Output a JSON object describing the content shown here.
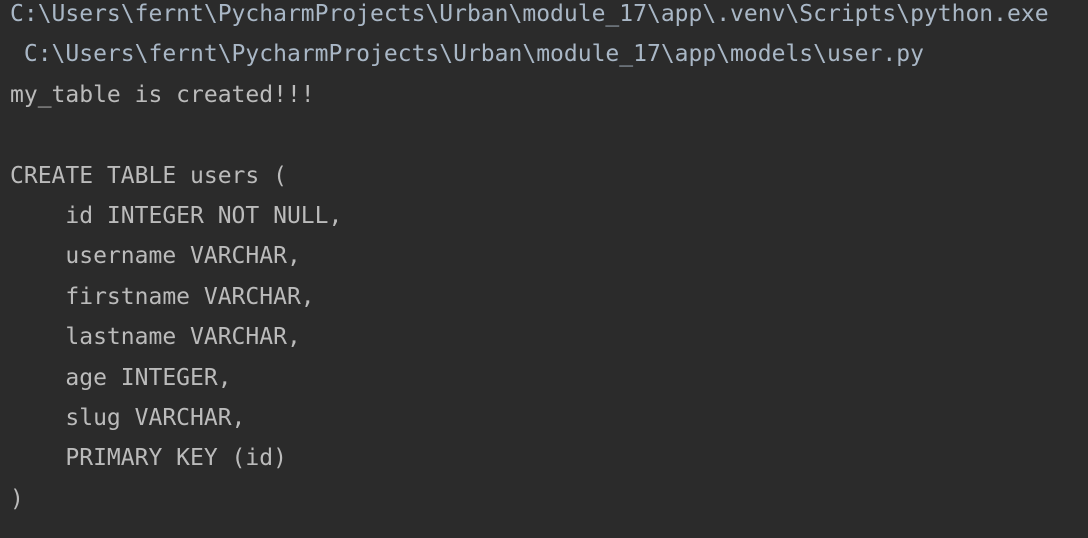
{
  "console": {
    "lines": [
      "C:\\Users\\fernt\\PycharmProjects\\Urban\\module_17\\app\\.venv\\Scripts\\python.exe",
      " C:\\Users\\fernt\\PycharmProjects\\Urban\\module_17\\app\\models\\user.py",
      "my_table is created!!!",
      "",
      "CREATE TABLE users (",
      "    id INTEGER NOT NULL,",
      "    username VARCHAR,",
      "    firstname VARCHAR,",
      "    lastname VARCHAR,",
      "    age INTEGER,",
      "    slug VARCHAR,",
      "    PRIMARY KEY (id)",
      ")"
    ]
  }
}
